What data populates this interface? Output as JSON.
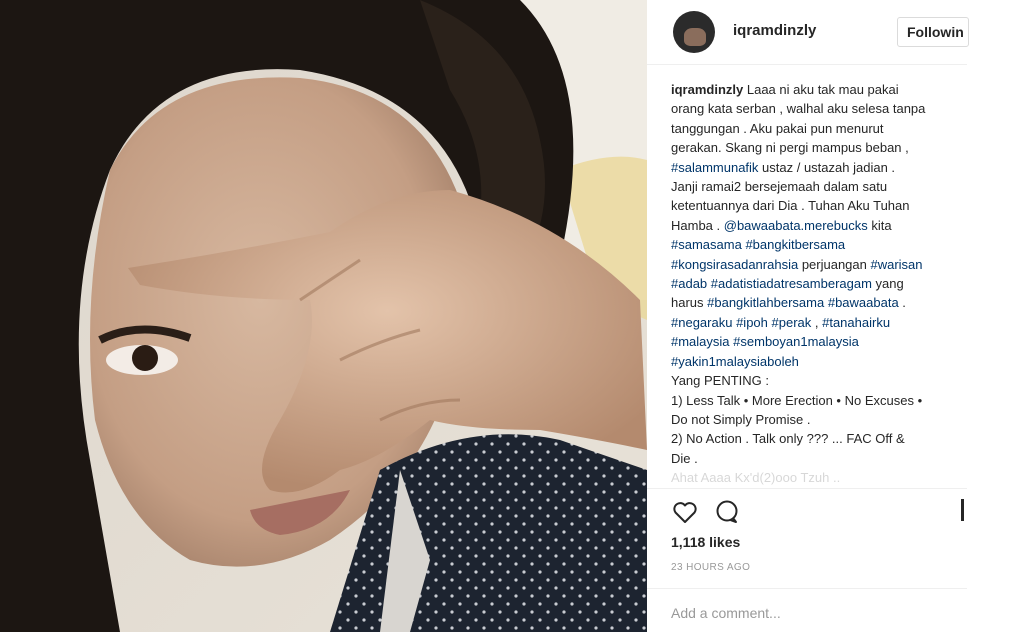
{
  "post": {
    "username": "iqramdinzly",
    "follow_label": "Followin",
    "caption_lines": [
      [
        {
          "t": "iqramdinzly",
          "c": "u"
        },
        {
          "t": " Laaa ni aku tak mau pakai"
        }
      ],
      [
        {
          "t": "orang kata serban , walhal aku selesa tanpa"
        }
      ],
      [
        {
          "t": "tanggungan . Aku pakai pun menurut"
        }
      ],
      [
        {
          "t": "gerakan. Skang ni pergi mampus beban ,"
        }
      ],
      [
        {
          "t": "#salammunafik",
          "c": "tag"
        },
        {
          "t": " ustaz / ustazah jadian ."
        }
      ],
      [
        {
          "t": "Janji ramai2 bersejemaah dalam satu"
        }
      ],
      [
        {
          "t": "ketentuannya dari Dia . Tuhan Aku Tuhan"
        }
      ],
      [
        {
          "t": "Hamba . "
        },
        {
          "t": "@bawaabata.merebucks",
          "c": "tag"
        },
        {
          "t": " kita"
        }
      ],
      [
        {
          "t": "#samasama",
          "c": "tag"
        },
        {
          "t": " "
        },
        {
          "t": "#bangkitbersama",
          "c": "tag"
        }
      ],
      [
        {
          "t": "#kongsirasadanrahsia",
          "c": "tag"
        },
        {
          "t": " perjuangan "
        },
        {
          "t": "#warisan",
          "c": "tag"
        }
      ],
      [
        {
          "t": "#adab",
          "c": "tag"
        },
        {
          "t": " "
        },
        {
          "t": "#adatistiadatresamberagam",
          "c": "tag"
        },
        {
          "t": " yang"
        }
      ],
      [
        {
          "t": "harus "
        },
        {
          "t": "#bangkitlahbersama",
          "c": "tag"
        },
        {
          "t": " "
        },
        {
          "t": "#bawaabata",
          "c": "tag"
        },
        {
          "t": " ."
        }
      ],
      [
        {
          "t": "#negaraku",
          "c": "tag"
        },
        {
          "t": " "
        },
        {
          "t": "#ipoh",
          "c": "tag"
        },
        {
          "t": " "
        },
        {
          "t": "#perak",
          "c": "tag"
        },
        {
          "t": " , "
        },
        {
          "t": "#tanahairku",
          "c": "tag"
        }
      ],
      [
        {
          "t": "#malaysia",
          "c": "tag"
        },
        {
          "t": " "
        },
        {
          "t": "#semboyan1malaysia",
          "c": "tag"
        }
      ],
      [
        {
          "t": "#yakin1malaysiaboleh",
          "c": "tag"
        }
      ],
      [
        {
          "t": "Yang PENTING :"
        }
      ],
      [
        {
          "t": "1) Less Talk • More Erection • No Excuses •"
        }
      ],
      [
        {
          "t": "Do not Simply Promise ."
        }
      ],
      [
        {
          "t": "2) No Action . Talk only ??? ... FAC Off &"
        }
      ],
      [
        {
          "t": "Die ."
        }
      ],
      [
        {
          "t": "Ahat Aaaa Kx'd(2)ooo Tzuh ..",
          "c": "faded"
        }
      ]
    ],
    "likes": "1,118 likes",
    "timestamp": "23 HOURS AGO",
    "comment_placeholder": "Add a comment..."
  },
  "icons": {
    "like": "heart-icon",
    "comment": "comment-bubble-icon"
  },
  "colors": {
    "hashtag": "#003569",
    "text": "#262626",
    "muted": "#999999",
    "border": "#efefef"
  }
}
